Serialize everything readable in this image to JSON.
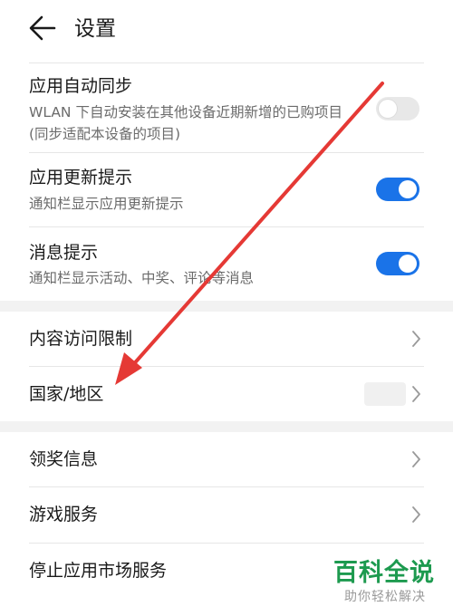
{
  "header": {
    "title": "设置"
  },
  "settings": {
    "auto_sync": {
      "title": "应用自动同步",
      "subtitle": "WLAN 下自动安装在其他设备近期新增的已购项目 (同步适配本设备的项目)",
      "enabled": false
    },
    "update_tip": {
      "title": "应用更新提示",
      "subtitle": "通知栏显示应用更新提示",
      "enabled": true
    },
    "message_tip": {
      "title": "消息提示",
      "subtitle": "通知栏显示活动、中奖、评论等消息",
      "enabled": true
    }
  },
  "nav": {
    "content_restriction": "内容访问限制",
    "country_region": "国家/地区",
    "rewards_info": "领奖信息",
    "game_service": "游戏服务",
    "stop_service": "停止应用市场服务"
  },
  "annotation": {
    "arrow_color": "#e53935"
  },
  "watermark": {
    "main": "百科全说",
    "sub": "助你轻松解决"
  },
  "colors": {
    "accent": "#1a73e8",
    "toggle_off": "#e8e8e8",
    "section_gap": "#f2f2f2",
    "watermark": "#1d9a4f"
  }
}
